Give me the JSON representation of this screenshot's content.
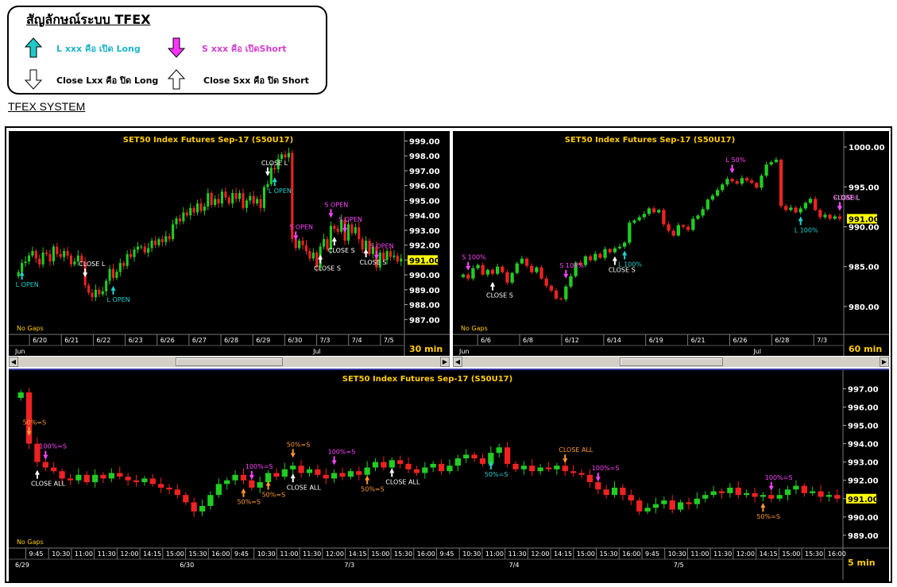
{
  "legend": {
    "title": "สัญลักษณ์ระบบ TFEX",
    "items": [
      {
        "text": "L xxx คือ เปิด Long",
        "color": "#1fb3c9",
        "arrow": "up-filled",
        "arrow_color": "#21c8c8"
      },
      {
        "text": "S xxx คือ เปิดShort",
        "color": "#d13fd1",
        "arrow": "down-filled",
        "arrow_color": "#ff33ff"
      },
      {
        "text": "Close Lxx คือ ปิด Long",
        "color": "#000000",
        "arrow": "down-outline",
        "arrow_color": "#ffffff"
      },
      {
        "text": "Close Sxx คือ ปิด Short",
        "color": "#000000",
        "arrow": "up-outline",
        "arrow_color": "#ffffff"
      }
    ]
  },
  "system_title": "TFEX SYSTEM",
  "colors": {
    "up": "#22cc22",
    "down": "#ee2222",
    "bg": "#000000",
    "title": "#ffcc00",
    "long": "#22d0d0",
    "short": "#ff44ff",
    "close": "#ffffff",
    "pct": "#ff9933",
    "price_tag": "#ffff00"
  },
  "chart_data": [
    {
      "type": "candlestick",
      "title": "SET50  Index  Futures  Sep-17  (S50U17)",
      "timeframe": "30  min",
      "gaps_label": "No Gaps",
      "ylim": [
        986.0,
        999.4
      ],
      "y_ticks": [
        "999.00",
        "998.00",
        "997.00",
        "996.00",
        "995.00",
        "994.00",
        "993.00",
        "992.00",
        "991.00",
        "990.00",
        "989.00",
        "988.00",
        "987.00"
      ],
      "x_ticks": [
        "6/20",
        "6/21",
        "6/22",
        "6/23",
        "6/26",
        "6/27",
        "6/28",
        "6/29",
        "6/30",
        "7/3",
        "7/4",
        "7/5"
      ],
      "month_labels": [
        "Jun",
        "Jul"
      ],
      "last_price": "991.00",
      "closes": [
        990.2,
        990.8,
        990.9,
        991.3,
        991.6,
        991.1,
        990.7,
        991.5,
        991.4,
        990.9,
        991.9,
        991.4,
        991.2,
        991.6,
        991.3,
        990.7,
        990.9,
        991.3,
        990.9,
        989.3,
        988.8,
        988.5,
        989.0,
        988.7,
        988.9,
        989.6,
        990.4,
        989.8,
        990.2,
        990.8,
        990.6,
        991.4,
        991.2,
        991.7,
        991.9,
        991.9,
        991.5,
        991.8,
        992.3,
        992.0,
        992.4,
        992.2,
        992.6,
        992.4,
        993.4,
        993.8,
        993.6,
        994.2,
        994.0,
        994.5,
        994.2,
        994.8,
        994.3,
        994.6,
        995.5,
        994.7,
        995.1,
        994.8,
        995.6,
        995.2,
        994.8,
        995.5,
        995.1,
        995.5,
        994.5,
        995.0,
        995.3,
        994.8,
        995.1,
        994.5,
        995.9,
        996.1,
        997.2,
        997.1,
        997.8,
        998.1,
        997.9,
        998.2,
        992.4,
        991.8,
        992.3,
        992.0,
        991.6,
        991.1,
        991.5,
        990.5,
        991.9,
        992.4,
        991.7,
        993.3,
        993.1,
        992.9,
        993.7,
        992.3,
        993.4,
        992.8,
        993.2,
        992.4,
        991.7,
        992.3,
        991.4,
        991.9,
        990.5,
        991.5,
        991.0,
        991.6,
        991.2,
        991.3,
        990.9,
        991.1
      ],
      "signals": [
        {
          "label": "L  OPEN",
          "kind": "long",
          "i": 1,
          "above": false
        },
        {
          "label": "CLOSE  L",
          "kind": "close",
          "i": 19,
          "above": true
        },
        {
          "label": "L  OPEN",
          "kind": "long",
          "i": 27,
          "above": false
        },
        {
          "label": "CLOSE  L",
          "kind": "close",
          "i": 71,
          "above": true
        },
        {
          "label": "L  OPEN",
          "kind": "long",
          "i": 73,
          "above": false
        },
        {
          "label": "S  OPEN",
          "kind": "short",
          "i": 79,
          "above": true
        },
        {
          "label": "CLOSE  S",
          "kind": "close",
          "i": 86,
          "above": false
        },
        {
          "label": "S  OPEN",
          "kind": "short",
          "i": 89,
          "above": true
        },
        {
          "label": "S  OPEN",
          "kind": "short",
          "i": 93,
          "above": true
        },
        {
          "label": "CLOSE  S",
          "kind": "close",
          "i": 90,
          "above": false
        },
        {
          "label": "CLOSE  S",
          "kind": "close",
          "i": 99,
          "above": false
        },
        {
          "label": "S  OPEN",
          "kind": "short",
          "i": 102,
          "above": true
        }
      ]
    },
    {
      "type": "candlestick",
      "title": "SET50  Index  Futures  Sep-17  (S50U17)",
      "timeframe": "60  min",
      "gaps_label": "No Gaps",
      "ylim": [
        976.5,
        1001.5
      ],
      "y_ticks": [
        "1000.00",
        "995.00",
        "990.00",
        "985.00",
        "980.00"
      ],
      "x_ticks": [
        "6/6",
        "6/8",
        "6/12",
        "6/14",
        "6/19",
        "6/21",
        "6/26",
        "6/28",
        "7/3"
      ],
      "month_labels": [
        "Jun",
        "Jul"
      ],
      "last_price": "991.00",
      "closes": [
        984.0,
        983.5,
        984.8,
        985.2,
        984.0,
        984.6,
        984.1,
        985.0,
        984.3,
        983.0,
        984.2,
        985.4,
        986.0,
        985.1,
        984.3,
        984.9,
        983.5,
        982.6,
        982.0,
        981.0,
        980.9,
        982.5,
        983.8,
        985.5,
        985.2,
        986.3,
        985.8,
        986.6,
        986.1,
        987.2,
        986.8,
        987.3,
        987.5,
        988.0,
        990.5,
        990.8,
        991.2,
        991.6,
        992.3,
        991.8,
        992.1,
        990.3,
        989.5,
        988.9,
        990.2,
        990.0,
        989.6,
        991.0,
        991.4,
        992.2,
        993.4,
        993.9,
        994.6,
        995.3,
        996.0,
        995.7,
        995.4,
        996.1,
        995.8,
        995.5,
        994.9,
        996.4,
        997.8,
        998.1,
        998.4,
        992.6,
        992.1,
        992.4,
        991.8,
        992.3,
        993.0,
        993.5,
        992.1,
        991.2,
        991.5,
        991.0,
        991.3,
        991.0
      ],
      "signals": [
        {
          "label": "S  100%",
          "kind": "short",
          "i": 1,
          "above": true
        },
        {
          "label": "CLOSE  S",
          "kind": "close",
          "i": 6,
          "above": false
        },
        {
          "label": "S  100%",
          "kind": "short",
          "i": 21,
          "above": true
        },
        {
          "label": "CLOSE  S",
          "kind": "close",
          "i": 31,
          "above": false
        },
        {
          "label": "L  100%",
          "kind": "long",
          "i": 33,
          "above": false
        },
        {
          "label": "L  50%",
          "kind": "short",
          "i": 55,
          "above": true
        },
        {
          "label": "L  100%",
          "kind": "long",
          "i": 69,
          "above": false
        },
        {
          "label": "CLOSE  L",
          "kind": "close",
          "i": 83,
          "above": true
        },
        {
          "label": "S  100%",
          "kind": "short",
          "i": 92,
          "above": true
        }
      ]
    },
    {
      "type": "candlestick",
      "title": "SET50  Index  Futures  Sep-17  (S50U17)",
      "timeframe": "5  min",
      "gaps_label": "No Gaps",
      "ylim": [
        988.3,
        997.8
      ],
      "y_ticks": [
        "997.00",
        "996.00",
        "995.00",
        "994.00",
        "993.00",
        "992.00",
        "991.00",
        "990.00",
        "989.00"
      ],
      "x_ticks": [
        "9:45",
        "10:30",
        "11:00",
        "11:30",
        "12:00",
        "14:15",
        "15:00",
        "15:30",
        "16:00",
        "9:45",
        "10:30",
        "11:00",
        "11:30",
        "12:00",
        "14:15",
        "15:00",
        "15:30",
        "16:00",
        "9:45",
        "10:30",
        "11:00",
        "11:30",
        "12:00",
        "14:15",
        "15:00",
        "15:30",
        "16:00",
        "9:45",
        "10:30",
        "11:00",
        "11:30",
        "12:00",
        "14:15",
        "15:00",
        "15:30",
        "16:00"
      ],
      "date_labels": [
        "6/29",
        "6/30",
        "7/3",
        "7/4",
        "7/5"
      ],
      "last_price": "991.00",
      "closes": [
        996.8,
        994.0,
        993.0,
        992.7,
        992.5,
        992.1,
        992.0,
        992.3,
        991.9,
        992.3,
        992.1,
        992.4,
        992.2,
        992.0,
        991.9,
        992.1,
        991.8,
        991.6,
        991.5,
        991.2,
        990.8,
        990.3,
        990.6,
        991.2,
        991.8,
        992.0,
        992.3,
        992.0,
        991.6,
        991.9,
        992.4,
        992.2,
        992.6,
        992.8,
        992.4,
        992.6,
        992.3,
        992.1,
        992.4,
        992.2,
        992.5,
        992.3,
        992.7,
        993.0,
        992.7,
        993.1,
        992.9,
        992.6,
        992.4,
        992.7,
        992.9,
        992.5,
        992.8,
        993.2,
        993.4,
        993.2,
        992.9,
        993.5,
        993.8,
        992.9,
        992.6,
        992.8,
        992.5,
        992.7,
        992.6,
        992.8,
        992.5,
        992.4,
        992.3,
        991.9,
        991.5,
        991.2,
        991.6,
        991.2,
        990.9,
        990.3,
        990.5,
        990.7,
        990.9,
        990.4,
        990.8,
        990.7,
        991.0,
        991.2,
        991.4,
        991.3,
        991.6,
        991.2,
        991.3,
        991.1,
        991.2,
        991.0,
        991.2,
        991.5,
        991.7,
        991.3,
        991.4,
        991.1,
        991.2,
        991.0
      ],
      "signals": [
        {
          "label": "50%=S",
          "kind": "pct",
          "i": 1,
          "above": true
        },
        {
          "label": "100%=S",
          "kind": "short",
          "i": 3,
          "above": true
        },
        {
          "label": "CLOSE  ALL",
          "kind": "close",
          "i": 2,
          "above": false
        },
        {
          "label": "50%=S",
          "kind": "pct",
          "i": 27,
          "above": false
        },
        {
          "label": "100%=S",
          "kind": "short",
          "i": 28,
          "above": true
        },
        {
          "label": "50%=S",
          "kind": "pct",
          "i": 30,
          "above": false
        },
        {
          "label": "50%=S",
          "kind": "pct",
          "i": 33,
          "above": true
        },
        {
          "label": "CLOSE  ALL",
          "kind": "close",
          "i": 33,
          "above": false
        },
        {
          "label": "100%=S",
          "kind": "short",
          "i": 38,
          "above": true
        },
        {
          "label": "50%=S",
          "kind": "pct",
          "i": 42,
          "above": false
        },
        {
          "label": "CLOSE  ALL",
          "kind": "close",
          "i": 45,
          "above": false
        },
        {
          "label": "50%=S",
          "kind": "long",
          "i": 57,
          "above": false
        },
        {
          "label": "CLOSE  ALL",
          "kind": "pct",
          "i": 66,
          "above": true
        },
        {
          "label": "100%=S",
          "kind": "short",
          "i": 70,
          "above": true
        },
        {
          "label": "50%=S",
          "kind": "pct",
          "i": 90,
          "above": false
        },
        {
          "label": "100%=S",
          "kind": "short",
          "i": 91,
          "above": true
        }
      ]
    }
  ]
}
